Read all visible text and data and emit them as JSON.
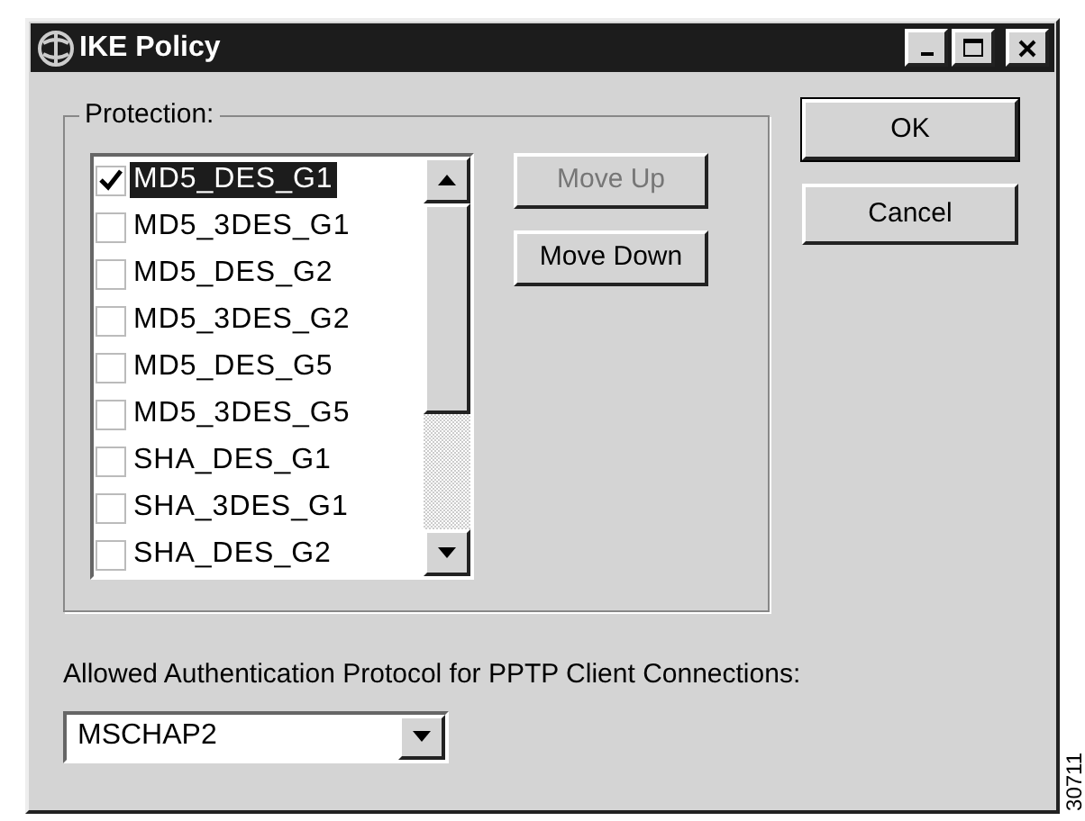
{
  "window": {
    "title": "IKE Policy"
  },
  "protection": {
    "label": "Protection:",
    "items": [
      {
        "label": "MD5_DES_G1",
        "checked": true,
        "selected": true
      },
      {
        "label": "MD5_3DES_G1",
        "checked": false,
        "selected": false
      },
      {
        "label": "MD5_DES_G2",
        "checked": false,
        "selected": false
      },
      {
        "label": "MD5_3DES_G2",
        "checked": false,
        "selected": false
      },
      {
        "label": "MD5_DES_G5",
        "checked": false,
        "selected": false
      },
      {
        "label": "MD5_3DES_G5",
        "checked": false,
        "selected": false
      },
      {
        "label": "SHA_DES_G1",
        "checked": false,
        "selected": false
      },
      {
        "label": "SHA_3DES_G1",
        "checked": false,
        "selected": false
      },
      {
        "label": "SHA_DES_G2",
        "checked": false,
        "selected": false
      }
    ],
    "buttons": [
      {
        "label": "Move Up",
        "disabled": true
      },
      {
        "label": "Move Down",
        "disabled": false
      }
    ]
  },
  "dialog_buttons": [
    {
      "label": "OK",
      "default": true
    },
    {
      "label": "Cancel",
      "default": false
    }
  ],
  "auth": {
    "label": "Allowed Authentication Protocol for PPTP Client Connections:",
    "value": "MSCHAP2"
  },
  "figure_id": "30711"
}
